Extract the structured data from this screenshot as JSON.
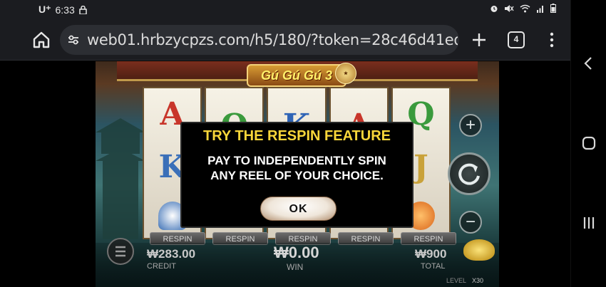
{
  "status_bar": {
    "carrier": "U⁺",
    "time": "6:33"
  },
  "browser": {
    "url": "web01.hrbzycpzs.com/h5/180/?token=28c46d41ed",
    "tab_count": "4"
  },
  "game": {
    "logo_text": "Gú Gú Gú 3",
    "reel_symbols": [
      [
        "A",
        "K"
      ],
      [
        "Q",
        ""
      ],
      [
        "K",
        ""
      ],
      [
        "A",
        ""
      ],
      [
        "Q",
        "J"
      ]
    ],
    "respin_labels": [
      "RESPIN",
      "RESPIN",
      "RESPIN",
      "RESPIN",
      "RESPIN"
    ],
    "credit_value": "₩283.00",
    "credit_label": "CREDIT",
    "win_value": "₩0.00",
    "win_label": "WIN",
    "total_value": "₩900",
    "total_label": "TOTAL",
    "level_label": "LEVEL",
    "level_value": "X30"
  },
  "dialog": {
    "title": "TRY THE RESPIN FEATURE",
    "message_line1": "PAY TO INDEPENDENTLY SPIN",
    "message_line2": "ANY REEL OF YOUR CHOICE.",
    "ok_label": "OK"
  },
  "colors": {
    "dialog_title": "#f8d63a",
    "browser_bg": "#1b1c20"
  }
}
